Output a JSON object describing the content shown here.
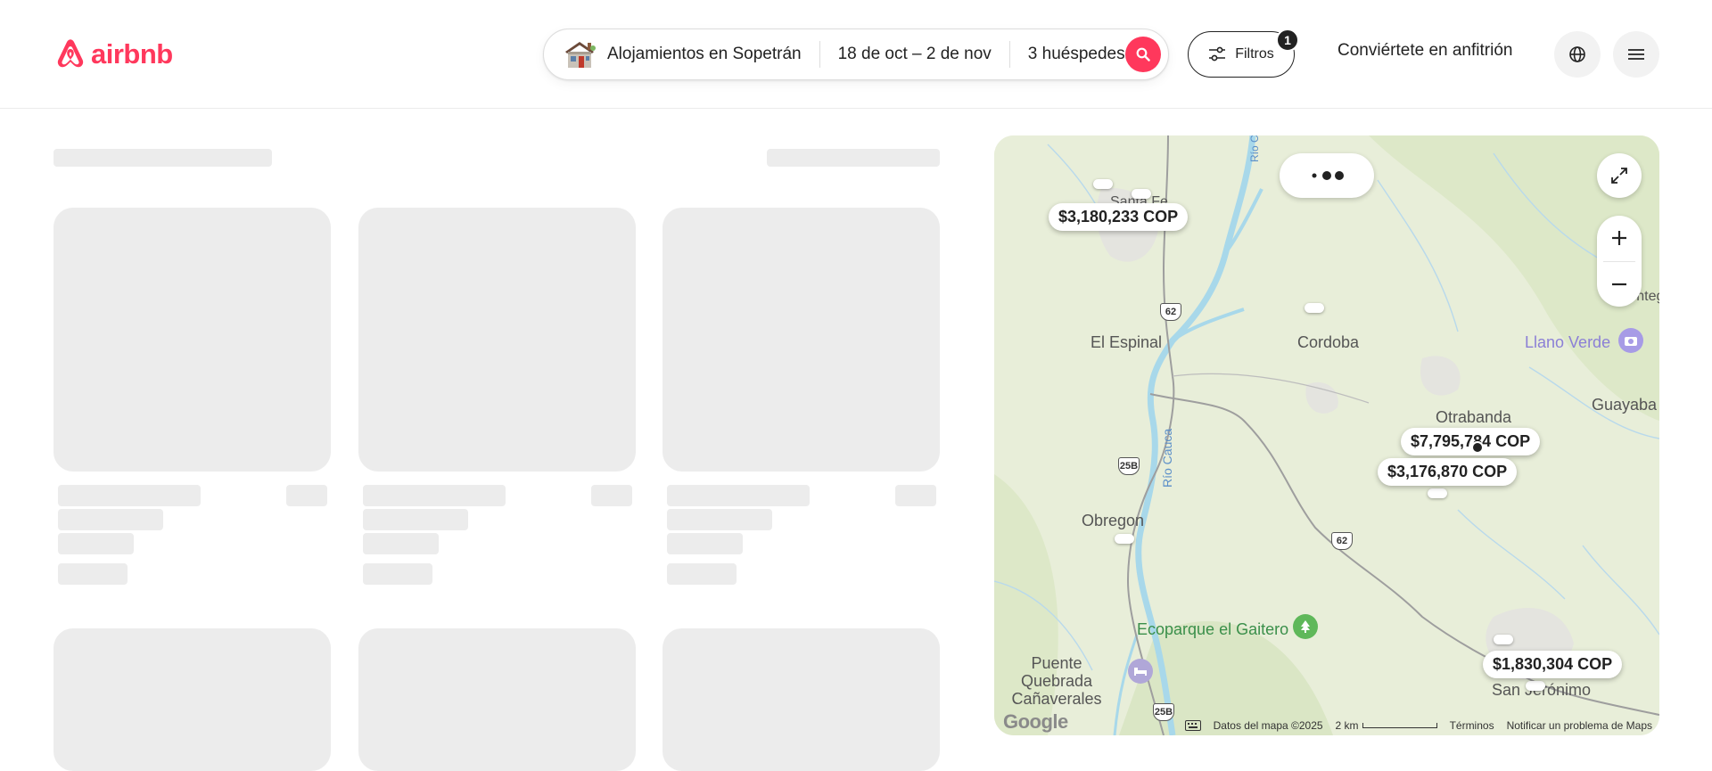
{
  "header": {
    "logo_text": "airbnb",
    "search": {
      "location": "Alojamientos en Sopetrán",
      "dates": "18 de oct – 2 de nov",
      "guests": "3 huéspedes"
    },
    "filters": {
      "label": "Filtros",
      "badge": "1"
    },
    "host_link": "Conviértete en anfitrión",
    "icons": {
      "logo": "airbnb-logo-icon",
      "house": "house-icon",
      "search": "search-icon",
      "filters": "sliders-icon",
      "globe": "globe-icon",
      "menu": "hamburger-menu-icon"
    }
  },
  "colors": {
    "brand": "#ff385c",
    "skeleton": "#ececec",
    "map_land": "#e8eed9",
    "map_water": "#a8d8ea"
  },
  "map": {
    "places": [
      "El Espinal",
      "Cordoba",
      "Llano Verde",
      "Guayaba",
      "Otrabanda",
      "Obregon",
      "Ecoparque el Gaitero",
      "Puente Quebrada Cañaverales",
      "San Jerónimo",
      "Santa Fe",
      "Montegra"
    ],
    "river_label": "Río Cauca",
    "road_shields": [
      "62",
      "25B",
      "62",
      "25B"
    ],
    "prices": [
      "$3,180,233 COP",
      "$7,795,784 COP",
      "$3,176,870 COP",
      "$1,830,304 COP"
    ],
    "footer": {
      "data": "Datos del mapa ©2025",
      "scale": "2 km",
      "terms": "Términos",
      "report": "Notificar un problema de Maps"
    },
    "google_logo": "Google",
    "icons": {
      "expand": "expand-icon",
      "zoom_in": "plus-icon",
      "zoom_out": "minus-icon",
      "loading": "loading-dots-icon",
      "keyboard": "keyboard-icon",
      "park": "tree-icon",
      "camera": "camera-icon",
      "lodging": "bed-icon"
    }
  }
}
